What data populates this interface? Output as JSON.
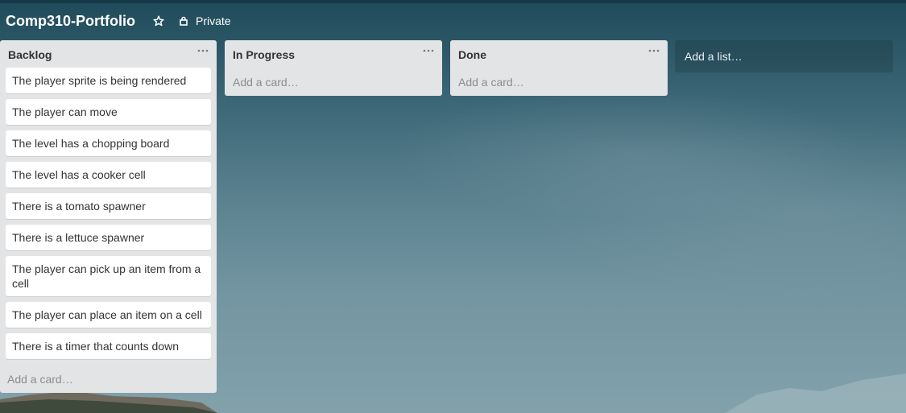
{
  "board": {
    "title": "Comp310-Portfolio",
    "star_icon": "star-icon",
    "privacy_label": "Private",
    "privacy_icon": "lock-icon"
  },
  "lists": [
    {
      "title": "Backlog",
      "menu_icon": "ellipsis-icon",
      "cards": [
        "The player sprite is being rendered",
        "The player can move",
        "The level has a chopping board",
        "The level has a cooker cell",
        "There is a tomato spawner",
        "There is a lettuce spawner",
        "The player can pick up an item from a cell",
        "The player can place an item on a cell",
        "There is a timer that counts down"
      ],
      "add_card_label": "Add a card…"
    },
    {
      "title": "In Progress",
      "menu_icon": "ellipsis-icon",
      "cards": [],
      "add_card_label": "Add a card…"
    },
    {
      "title": "Done",
      "menu_icon": "ellipsis-icon",
      "cards": [],
      "add_card_label": "Add a card…"
    }
  ],
  "add_list_label": "Add a list…",
  "colors": {
    "list_background": "#e2e4e6",
    "card_background": "#ffffff",
    "header_text": "#ffffff"
  }
}
